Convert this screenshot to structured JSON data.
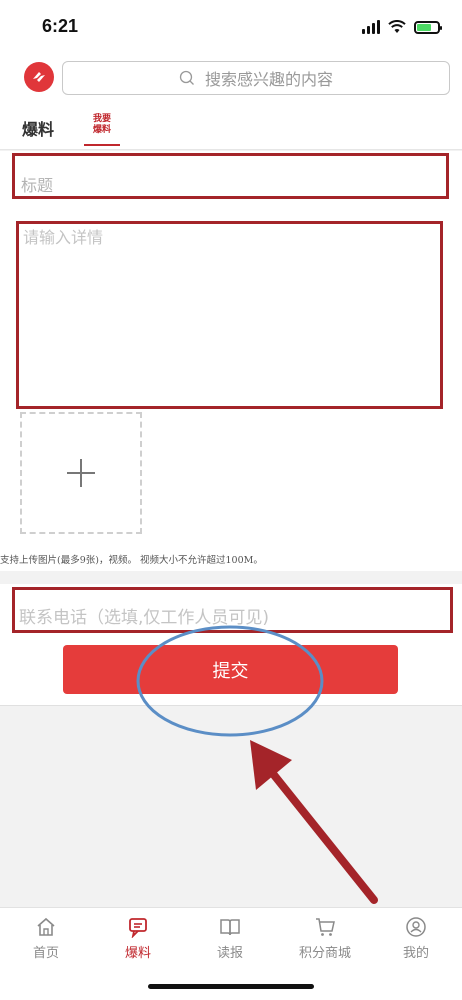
{
  "status_bar": {
    "time": "6:21"
  },
  "header": {
    "search_placeholder": "搜索感兴趣的内容",
    "brand_color": "#e0363a"
  },
  "tabs": [
    {
      "label": "爆料",
      "active": false
    },
    {
      "label": "我要爆料",
      "label_line1": "我要",
      "label_line2": "爆料",
      "active": true
    }
  ],
  "form": {
    "title_placeholder": "标题",
    "detail_placeholder": "请输入详情",
    "upload_hint": "支持上传图片(最多9张)，视频。 视频大小不允许超过100M。",
    "phone_placeholder": "联系电话（选填,仅工作人员可见)",
    "submit_label": "提交"
  },
  "bottom_nav": [
    {
      "label": "首页",
      "icon": "home-icon",
      "active": false
    },
    {
      "label": "爆料",
      "icon": "report-icon",
      "active": true
    },
    {
      "label": "读报",
      "icon": "book-icon",
      "active": false
    },
    {
      "label": "积分商城",
      "icon": "cart-icon",
      "active": false
    },
    {
      "label": "我的",
      "icon": "user-icon",
      "active": false
    }
  ],
  "colors": {
    "accent": "#e53c3b",
    "active_tab": "#c0272d",
    "annotation_red": "#a42429",
    "annotation_blue": "#5b8ec6"
  }
}
